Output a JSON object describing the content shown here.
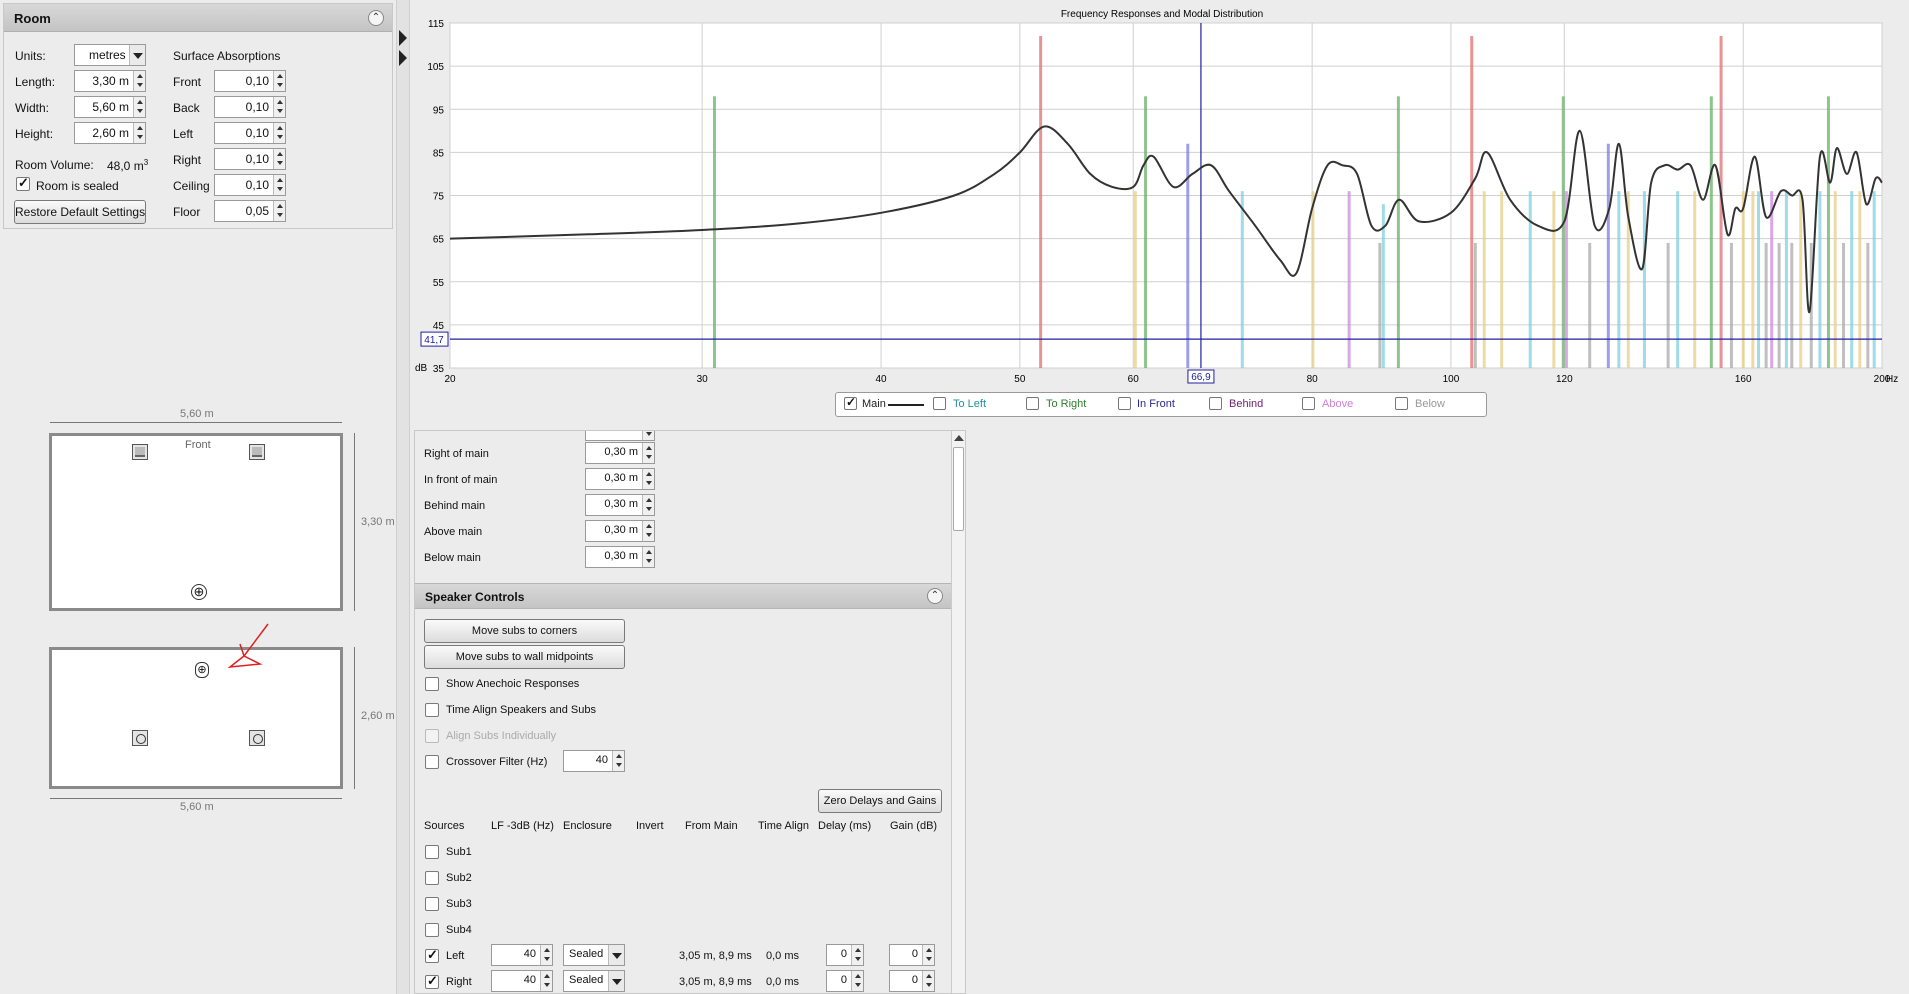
{
  "room": {
    "title": "Room",
    "units_label": "Units:",
    "units_value": "metres",
    "length_label": "Length:",
    "length_value": "3,30 m",
    "width_label": "Width:",
    "width_value": "5,60 m",
    "height_label": "Height:",
    "height_value": "2,60 m",
    "volume_label": "Room Volume:",
    "volume_value": "48,0 m",
    "volume_exp": "3",
    "sealed_label": "Room is sealed",
    "restore_label": "Restore Default Settings",
    "absorption_title": "Surface Absorptions",
    "surfaces": [
      {
        "label": "Front",
        "value": "0,10"
      },
      {
        "label": "Back",
        "value": "0,10"
      },
      {
        "label": "Left",
        "value": "0,10"
      },
      {
        "label": "Right",
        "value": "0,10"
      },
      {
        "label": "Ceiling",
        "value": "0,10"
      },
      {
        "label": "Floor",
        "value": "0,05"
      }
    ]
  },
  "diagram": {
    "top_width": "5,60 m",
    "top_depth": "3,30 m",
    "front_label": "Front",
    "side_height": "2,60 m",
    "bottom_width": "5,60 m"
  },
  "chart_data": {
    "type": "line",
    "title": "Frequency Responses and Modal Distribution",
    "x_unit": "Hz",
    "y_unit": "dB",
    "x_scale": "log",
    "xlim": [
      20,
      200
    ],
    "ylim": [
      35,
      115
    ],
    "x_ticks": [
      20,
      30,
      40,
      50,
      60,
      80,
      100,
      120,
      160,
      200
    ],
    "y_ticks": [
      35,
      45,
      55,
      65,
      75,
      85,
      95,
      105,
      115
    ],
    "cursor_x": "66,9",
    "cursor_y": "41,7",
    "cursor_x_value": 66.9,
    "cursor_y_value": 41.7,
    "series": [
      {
        "name": "Main",
        "color": "#333333",
        "x": [
          20,
          25,
          30,
          35,
          40,
          45,
          48,
          50,
          52,
          54,
          56,
          58,
          60,
          61,
          62,
          64,
          66,
          68,
          70,
          73,
          76,
          78,
          80,
          82,
          84,
          86,
          88,
          90,
          92,
          95,
          100,
          104,
          106,
          110,
          115,
          120,
          123,
          126,
          129,
          131,
          133,
          136,
          138,
          141,
          144,
          147,
          150,
          153,
          156,
          158,
          160,
          163,
          166,
          170,
          173,
          176,
          178,
          181,
          184,
          186,
          189,
          192,
          195,
          198,
          200
        ],
        "y": [
          65,
          66,
          67,
          68.5,
          71,
          75,
          80,
          85,
          91,
          87,
          80,
          77,
          77,
          82,
          84,
          77,
          80,
          82,
          76,
          68,
          60,
          57,
          72,
          82,
          82,
          80,
          68,
          68,
          74,
          69,
          71,
          79,
          85,
          74,
          68,
          69,
          90,
          68,
          72,
          87,
          70,
          58,
          78,
          82,
          81,
          82,
          74,
          82,
          66,
          72,
          72,
          84,
          70,
          76,
          75,
          74,
          48,
          84,
          78,
          86,
          80,
          85,
          73,
          79,
          78
        ]
      },
      {
        "name": "To Left",
        "color": "#3aa6b9"
      },
      {
        "name": "To Right",
        "color": "#2e8b2e"
      },
      {
        "name": "In Front",
        "color": "#1f1f8f"
      },
      {
        "name": "Behind",
        "color": "#7b1f7b"
      },
      {
        "name": "Above",
        "color": "#cc66cc"
      },
      {
        "name": "Below",
        "color": "#aaaaaa"
      }
    ],
    "modes": [
      {
        "f": 30.6,
        "h": 98,
        "c": "#6ab06a"
      },
      {
        "f": 51.7,
        "h": 112,
        "c": "#e07070"
      },
      {
        "f": 60.2,
        "h": 76,
        "c": "#e6cf8a"
      },
      {
        "f": 61.2,
        "h": 98,
        "c": "#6ab06a"
      },
      {
        "f": 65.5,
        "h": 87,
        "c": "#7f7fe0"
      },
      {
        "f": 71.5,
        "h": 76,
        "c": "#80cfe0"
      },
      {
        "f": 80.1,
        "h": 76,
        "c": "#e6cf8a"
      },
      {
        "f": 84.9,
        "h": 76,
        "c": "#cc88dd"
      },
      {
        "f": 89.2,
        "h": 64,
        "c": "#aaaaaa"
      },
      {
        "f": 89.7,
        "h": 73,
        "c": "#80cfe0"
      },
      {
        "f": 91.9,
        "h": 98,
        "c": "#6ab06a"
      },
      {
        "f": 103.4,
        "h": 112,
        "c": "#e07070"
      },
      {
        "f": 104.0,
        "h": 64,
        "c": "#aaaaaa"
      },
      {
        "f": 105.5,
        "h": 76,
        "c": "#e6cf8a"
      },
      {
        "f": 108.5,
        "h": 76,
        "c": "#e6cf8a"
      },
      {
        "f": 113.6,
        "h": 76,
        "c": "#80cfe0"
      },
      {
        "f": 118.0,
        "h": 76,
        "c": "#e6cf8a"
      },
      {
        "f": 119.8,
        "h": 98,
        "c": "#6ab06a"
      },
      {
        "f": 120.4,
        "h": 76,
        "c": "#cc88dd"
      },
      {
        "f": 125.0,
        "h": 64,
        "c": "#aaaaaa"
      },
      {
        "f": 128.8,
        "h": 87,
        "c": "#7f7fe0"
      },
      {
        "f": 131.0,
        "h": 76,
        "c": "#80cfe0"
      },
      {
        "f": 133.0,
        "h": 76,
        "c": "#e6cf8a"
      },
      {
        "f": 136.5,
        "h": 76,
        "c": "#80cfe0"
      },
      {
        "f": 141.8,
        "h": 64,
        "c": "#aaaaaa"
      },
      {
        "f": 144.0,
        "h": 76,
        "c": "#80cfe0"
      },
      {
        "f": 148.0,
        "h": 76,
        "c": "#e6cf8a"
      },
      {
        "f": 152.0,
        "h": 98,
        "c": "#6ab06a"
      },
      {
        "f": 154.4,
        "h": 112,
        "c": "#e07070"
      },
      {
        "f": 157.0,
        "h": 64,
        "c": "#aaaaaa"
      },
      {
        "f": 160.0,
        "h": 76,
        "c": "#e6cf8a"
      },
      {
        "f": 162.5,
        "h": 76,
        "c": "#e6cf8a"
      },
      {
        "f": 164.0,
        "h": 76,
        "c": "#80cfe0"
      },
      {
        "f": 166.0,
        "h": 64,
        "c": "#aaaaaa"
      },
      {
        "f": 167.5,
        "h": 76,
        "c": "#cc88dd"
      },
      {
        "f": 169.5,
        "h": 64,
        "c": "#aaaaaa"
      },
      {
        "f": 171.5,
        "h": 76,
        "c": "#80cfe0"
      },
      {
        "f": 173.0,
        "h": 64,
        "c": "#aaaaaa"
      },
      {
        "f": 175.5,
        "h": 76,
        "c": "#e6cf8a"
      },
      {
        "f": 178.5,
        "h": 64,
        "c": "#aaaaaa"
      },
      {
        "f": 181.0,
        "h": 76,
        "c": "#80cfe0"
      },
      {
        "f": 183.5,
        "h": 98,
        "c": "#6ab06a"
      },
      {
        "f": 185.5,
        "h": 76,
        "c": "#e6cf8a"
      },
      {
        "f": 188.0,
        "h": 64,
        "c": "#aaaaaa"
      },
      {
        "f": 190.5,
        "h": 76,
        "c": "#80cfe0"
      },
      {
        "f": 193.0,
        "h": 76,
        "c": "#e6cf8a"
      },
      {
        "f": 195.5,
        "h": 64,
        "c": "#aaaaaa"
      },
      {
        "f": 197.5,
        "h": 76,
        "c": "#80cfe0"
      }
    ]
  },
  "legend": [
    {
      "label": "Main",
      "checked": true,
      "color": "#222222"
    },
    {
      "label": "To Left",
      "checked": false,
      "color": "#1e8fa0"
    },
    {
      "label": "To Right",
      "checked": false,
      "color": "#2e7d2e"
    },
    {
      "label": "In Front",
      "checked": false,
      "color": "#2a2a8f"
    },
    {
      "label": "Behind",
      "checked": false,
      "color": "#6e1f6e"
    },
    {
      "label": "Above",
      "checked": false,
      "color": "#d07ed0"
    },
    {
      "label": "Below",
      "checked": false,
      "color": "#999999"
    }
  ],
  "offsets": [
    {
      "label": "Right of main",
      "value": "0,30 m"
    },
    {
      "label": "In front of main",
      "value": "0,30 m"
    },
    {
      "label": "Behind main",
      "value": "0,30 m"
    },
    {
      "label": "Above main",
      "value": "0,30 m"
    },
    {
      "label": "Below main",
      "value": "0,30 m"
    }
  ],
  "speaker_controls": {
    "title": "Speaker Controls",
    "move_corners": "Move subs to corners",
    "move_midpoints": "Move subs to wall midpoints",
    "show_anechoic": "Show Anechoic Responses",
    "time_align": "Time Align Speakers and Subs",
    "align_subs": "Align Subs Individually",
    "crossover": "Crossover Filter (Hz)",
    "crossover_value": "40",
    "zero_delays": "Zero Delays and Gains",
    "headers": [
      "Sources",
      "LF -3dB (Hz)",
      "Enclosure",
      "Invert",
      "From Main",
      "Time Align",
      "Delay (ms)",
      "Gain (dB)"
    ],
    "subs": [
      "Sub1",
      "Sub2",
      "Sub3",
      "Sub4"
    ],
    "sources": [
      {
        "name": "Left",
        "lf": "40",
        "enclosure": "Sealed",
        "from_main": "3,05 m, 8,9 ms",
        "time_align": "0,0 ms",
        "delay": "0",
        "gain": "0"
      },
      {
        "name": "Right",
        "lf": "40",
        "enclosure": "Sealed",
        "from_main": "3,05 m, 8,9 ms",
        "time_align": "0,0 ms",
        "delay": "0",
        "gain": "0"
      }
    ]
  }
}
